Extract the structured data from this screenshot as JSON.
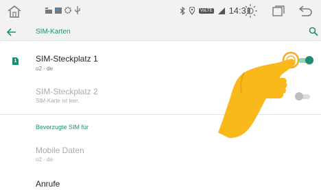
{
  "status_bar": {
    "time": "14:31",
    "network_badge": "VoLTE",
    "icons": [
      "home-icon",
      "photo-notification-icon",
      "image-notification-icon",
      "settings-notification-icon",
      "usb-notification-icon",
      "bluetooth-icon",
      "location-icon",
      "volte-icon",
      "signal-icon",
      "brightness-icon",
      "recents-icon",
      "back-icon"
    ]
  },
  "app_bar": {
    "title": "SIM-Karten"
  },
  "sim_slots": [
    {
      "name": "SIM-Steckplatz 1",
      "subtitle": "o2 - de",
      "enabled": true,
      "badge": "1"
    },
    {
      "name": "SIM-Steckplatz 2",
      "subtitle": "SIM-Karte ist leer.",
      "enabled": false
    }
  ],
  "preferred": {
    "header": "Bevorzugte SIM für",
    "items": [
      {
        "label": "Mobile Daten",
        "value": "o2 - de"
      },
      {
        "label": "Anrufe",
        "value": ""
      }
    ]
  },
  "colors": {
    "accent": "#1e8e73",
    "accent_light": "#8fd3c0",
    "hand": "#f9b91b",
    "ring": "#f2a20c",
    "bar_bg": "#f2f2f2"
  }
}
